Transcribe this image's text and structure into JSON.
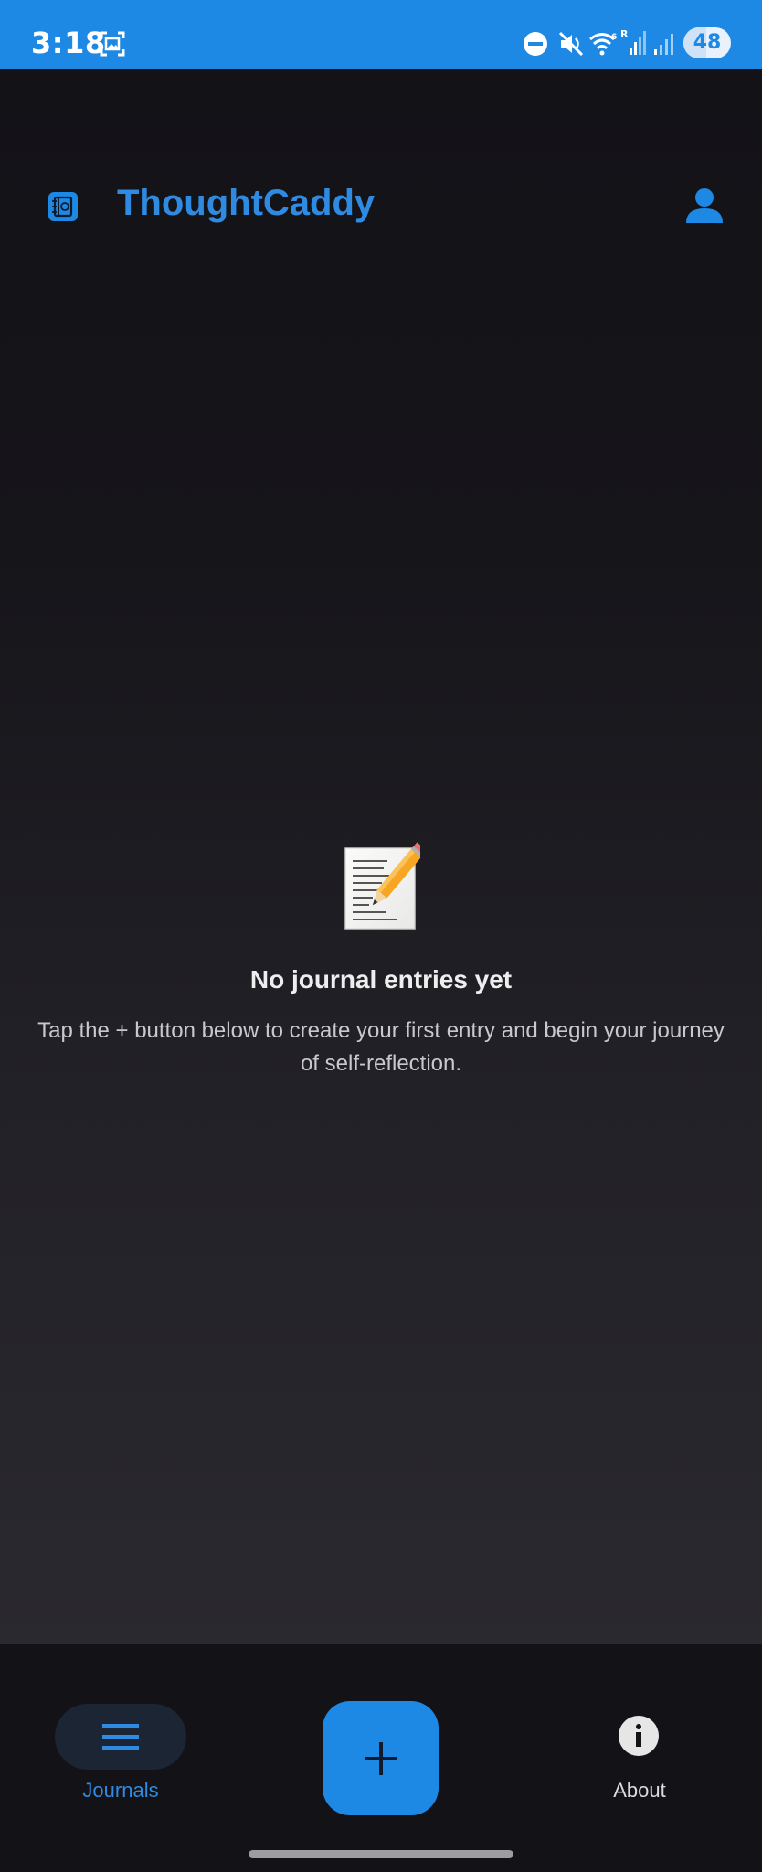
{
  "status_bar": {
    "time": "3:18",
    "battery": "48",
    "icons": [
      "screenshot-icon",
      "do-not-disturb-icon",
      "mute-icon",
      "wifi-icon",
      "signal-icon",
      "signal-weak-icon",
      "battery-icon"
    ]
  },
  "header": {
    "title": "ThoughtCaddy",
    "logo_icon": "journal-book-icon",
    "profile_icon": "person-icon"
  },
  "empty_state": {
    "emoji": "memo-pencil-icon",
    "title": "No journal entries yet",
    "description": "Tap the + button below to create your first entry and begin your journey of self-reflection."
  },
  "bottom_nav": {
    "items": [
      {
        "label": "Journals",
        "icon": "menu-lines-icon",
        "active": true
      },
      {
        "label": "About",
        "icon": "info-icon",
        "active": false
      }
    ],
    "fab_icon": "plus-icon"
  },
  "colors": {
    "accent": "#1e88e5",
    "title": "#2f8ae2",
    "background": "#131217"
  }
}
